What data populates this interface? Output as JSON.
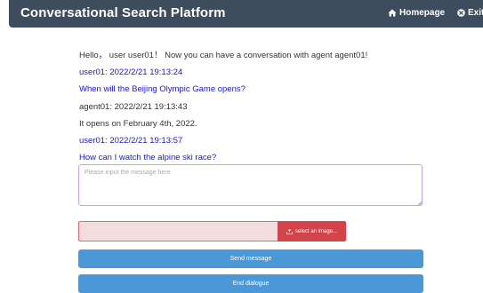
{
  "navbar": {
    "brand": "Conversational Search Platform",
    "home_label": "Homepage",
    "exit_label": "Exit"
  },
  "chat": {
    "greeting": "Hello， user user01！ Now you can have a conversation with agent agent01!",
    "messages": [
      {
        "speaker": "user",
        "header": "user01: 2022/2/21 19:13:24",
        "text": "When will the Beijing Olympic Game opens?"
      },
      {
        "speaker": "agent",
        "header": "agent01: 2022/2/21 19:13:43",
        "text": "It opens on February 4th, 2022."
      },
      {
        "speaker": "user",
        "header": "user01: 2022/2/21 19:13:57",
        "text": "How can I watch the alpine ski race?"
      }
    ]
  },
  "composer": {
    "placeholder": "Please input the message here",
    "value": ""
  },
  "upload": {
    "button_label": "select an image..."
  },
  "actions": {
    "send_label": "Send message",
    "end_label": "End dialogue"
  },
  "colors": {
    "navbar": "#3d4d5d",
    "user_text": "#1a1ad6",
    "agent_text": "#333333",
    "upload_button": "#d2434c",
    "primary_button": "#4a98d8"
  },
  "icons": {
    "home": "home-icon",
    "exit": "close-circle-icon",
    "upload": "upload-icon"
  }
}
